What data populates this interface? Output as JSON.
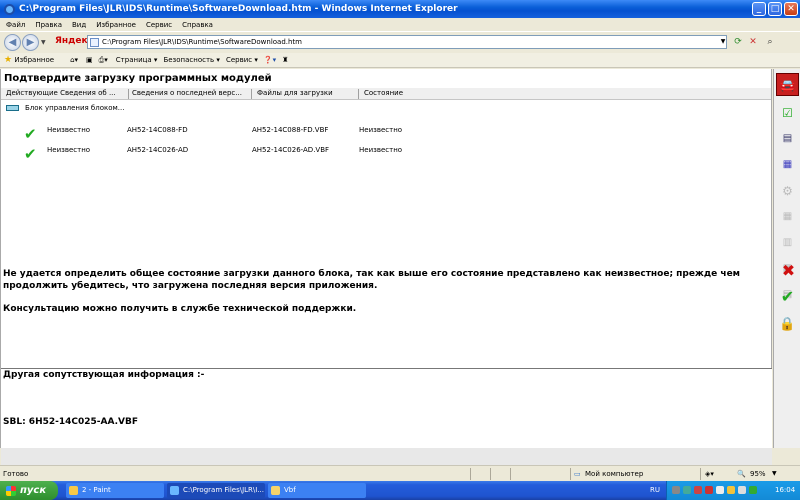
{
  "window": {
    "title": "C:\\Program Files\\JLR\\IDS\\Runtime\\SoftwareDownload.htm - Windows Internet Explorer"
  },
  "menu": [
    "Файл",
    "Правка",
    "Вид",
    "Избранное",
    "Сервис",
    "Справка"
  ],
  "address": {
    "brand": "Яндекс",
    "url": "C:\\Program Files\\JLR\\IDS\\Runtime\\SoftwareDownload.htm"
  },
  "favorites_bar": {
    "favorites_label": "Избранное",
    "page_label": "Страница",
    "safety_label": "Безопасность",
    "tools_label": "Сервис"
  },
  "page": {
    "title": "Подтвердите загрузку программных модулей",
    "columns": [
      "Действующие Сведения об ...",
      "Сведения о последней верс...",
      "Файлы для загрузки",
      "Состояние"
    ],
    "group_label": "Блок управления блоком...",
    "rows": [
      {
        "current": "Неизвестно",
        "latest": "AH52-14C088-FD",
        "file": "AH52-14C088-FD.VBF",
        "status": "Неизвестно"
      },
      {
        "current": "Неизвестно",
        "latest": "AH52-14C026-AD",
        "file": "AH52-14C026-AD.VBF",
        "status": "Неизвестно"
      }
    ],
    "message": "Не удается определить общее состояние загрузки данного блока, так как выше его состояние представлено как неизвестное; прежде чем продолжить убедитесь, что загружена последняя версия приложения.",
    "support": "Консультацию можно получить в службе технической поддержки.",
    "other_info_header": "Другая сопутствующая информация :-",
    "sbl": "SBL: 6H52-14C025-AA.VBF"
  },
  "status_bar": {
    "status": "Готово",
    "zone": "Мой компьютер",
    "zoom": "95%"
  },
  "taskbar": {
    "start": "пуск",
    "tasks": [
      "2 - Paint",
      "C:\\Program Files\\JLR\\I...",
      "Vbf"
    ],
    "language": "RU",
    "clock": "16:04"
  },
  "colors": {
    "xp_blue": "#0a5fd8",
    "check_green": "#22aa22",
    "cancel_red": "#d01010",
    "start_green": "#2e8e2e"
  }
}
